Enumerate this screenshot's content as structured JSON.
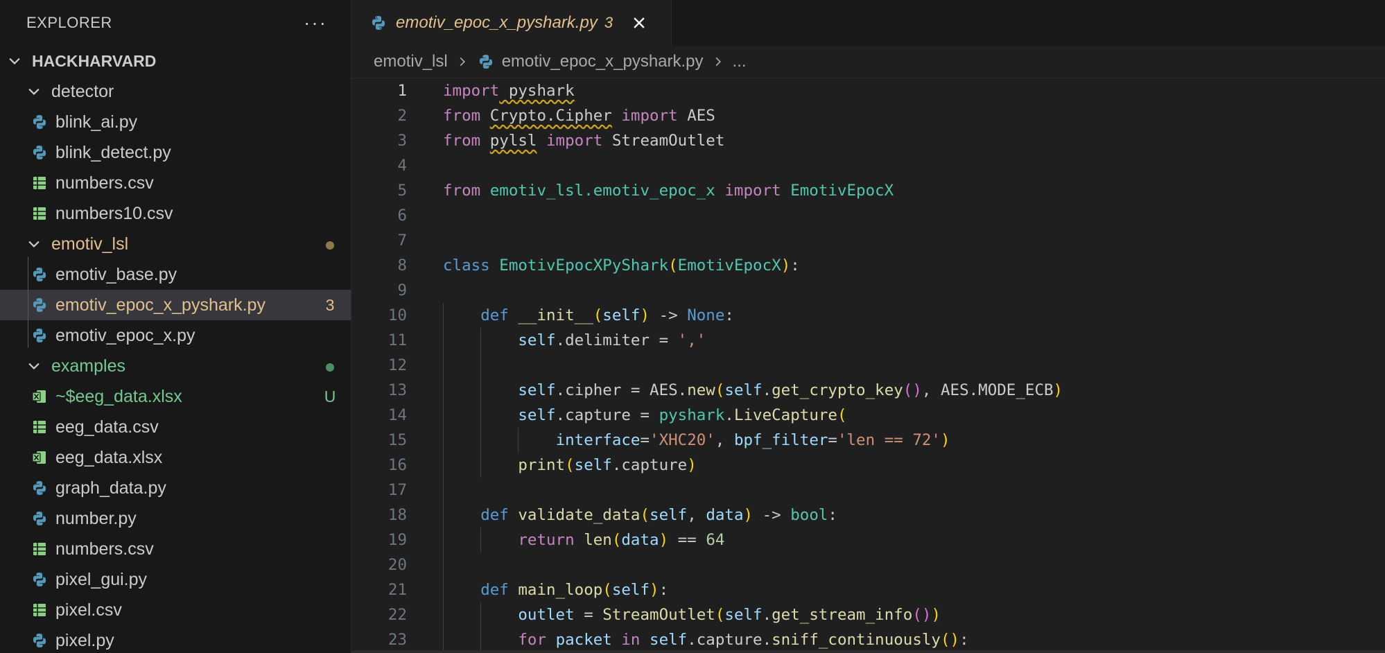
{
  "explorer": {
    "title": "EXPLORER",
    "more": "···",
    "workspace": "HACKHARVARD",
    "items": [
      {
        "type": "folder",
        "label": "detector",
        "color": "#cccccc",
        "badge": ""
      },
      {
        "type": "py",
        "label": "blink_ai.py",
        "color": "#cccccc",
        "badge": ""
      },
      {
        "type": "py",
        "label": "blink_detect.py",
        "color": "#cccccc",
        "badge": ""
      },
      {
        "type": "csv",
        "label": "numbers.csv",
        "color": "#cccccc",
        "badge": ""
      },
      {
        "type": "csv",
        "label": "numbers10.csv",
        "color": "#cccccc",
        "badge": ""
      },
      {
        "type": "folder",
        "label": "emotiv_lsl",
        "color": "#e2c08d",
        "badge": "dot-modified"
      },
      {
        "type": "py",
        "label": "emotiv_base.py",
        "color": "#cccccc",
        "badge": ""
      },
      {
        "type": "py",
        "label": "emotiv_epoc_x_pyshark.py",
        "color": "#e2c08d",
        "badge": "3",
        "selected": true
      },
      {
        "type": "py",
        "label": "emotiv_epoc_x.py",
        "color": "#cccccc",
        "badge": ""
      },
      {
        "type": "folder",
        "label": "examples",
        "color": "#73c991",
        "badge": "dot-untracked"
      },
      {
        "type": "xlsx",
        "label": "~$eeg_data.xlsx",
        "color": "#73c991",
        "badge": "U"
      },
      {
        "type": "csv",
        "label": "eeg_data.csv",
        "color": "#cccccc",
        "badge": ""
      },
      {
        "type": "xlsx",
        "label": "eeg_data.xlsx",
        "color": "#cccccc",
        "badge": ""
      },
      {
        "type": "py",
        "label": "graph_data.py",
        "color": "#cccccc",
        "badge": ""
      },
      {
        "type": "py",
        "label": "number.py",
        "color": "#cccccc",
        "badge": ""
      },
      {
        "type": "csv",
        "label": "numbers.csv",
        "color": "#cccccc",
        "badge": ""
      },
      {
        "type": "py",
        "label": "pixel_gui.py",
        "color": "#cccccc",
        "badge": ""
      },
      {
        "type": "csv",
        "label": "pixel.csv",
        "color": "#cccccc",
        "badge": ""
      },
      {
        "type": "py",
        "label": "pixel.py",
        "color": "#cccccc",
        "badge": ""
      }
    ]
  },
  "tab": {
    "title": "emotiv_epoc_x_pyshark.py",
    "count": "3"
  },
  "breadcrumb": {
    "folder": "emotiv_lsl",
    "file": "emotiv_epoc_x_pyshark.py",
    "more": "..."
  },
  "colors": {
    "modified": "#e2c08d",
    "untracked": "#73c991",
    "python": "#519aba",
    "csv": "#89d185"
  },
  "code_lines": [
    {
      "n": "1",
      "indent": 0,
      "tokens": [
        [
          "kw",
          "import"
        ],
        [
          "",
          ""
        ],
        [
          "sq",
          " pyshark"
        ]
      ]
    },
    {
      "n": "2",
      "indent": 0,
      "tokens": [
        [
          "kw",
          "from"
        ],
        [
          "",
          " "
        ],
        [
          "sq",
          "Crypto.Cipher"
        ],
        [
          "",
          " "
        ],
        [
          "kw",
          "import"
        ],
        [
          "",
          " AES"
        ]
      ]
    },
    {
      "n": "3",
      "indent": 0,
      "tokens": [
        [
          "kw",
          "from"
        ],
        [
          "",
          " "
        ],
        [
          "sq",
          "pylsl"
        ],
        [
          "",
          " "
        ],
        [
          "kw",
          "import"
        ],
        [
          "",
          " StreamOutlet"
        ]
      ]
    },
    {
      "n": "4",
      "indent": 0,
      "tokens": []
    },
    {
      "n": "5",
      "indent": 0,
      "tokens": [
        [
          "kw",
          "from"
        ],
        [
          "",
          " "
        ],
        [
          "cls",
          "emotiv_lsl.emotiv_epoc_x"
        ],
        [
          "",
          " "
        ],
        [
          "kw",
          "import"
        ],
        [
          "",
          " "
        ],
        [
          "cls",
          "EmotivEpocX"
        ]
      ]
    },
    {
      "n": "6",
      "indent": 0,
      "tokens": []
    },
    {
      "n": "7",
      "indent": 0,
      "tokens": []
    },
    {
      "n": "8",
      "indent": 0,
      "tokens": [
        [
          "kwd",
          "class"
        ],
        [
          "",
          " "
        ],
        [
          "cls",
          "EmotivEpocXPyShark"
        ],
        [
          "paren",
          "("
        ],
        [
          "cls",
          "EmotivEpocX"
        ],
        [
          "paren",
          ")"
        ],
        [
          "",
          ":"
        ]
      ]
    },
    {
      "n": "9",
      "indent": 0,
      "tokens": []
    },
    {
      "n": "10",
      "indent": 1,
      "tokens": [
        [
          "kwd",
          "def"
        ],
        [
          "",
          " "
        ],
        [
          "fn",
          "__init__"
        ],
        [
          "paren",
          "("
        ],
        [
          "var",
          "self"
        ],
        [
          "paren",
          ")"
        ],
        [
          "",
          " -> "
        ],
        [
          "kwd",
          "None"
        ],
        [
          "",
          ":"
        ]
      ]
    },
    {
      "n": "11",
      "indent": 2,
      "tokens": [
        [
          "var",
          "self"
        ],
        [
          "",
          ".delimiter = "
        ],
        [
          "str",
          "','"
        ]
      ]
    },
    {
      "n": "12",
      "indent": 2,
      "tokens": []
    },
    {
      "n": "13",
      "indent": 2,
      "tokens": [
        [
          "var",
          "self"
        ],
        [
          "",
          ".cipher = AES."
        ],
        [
          "fn",
          "new"
        ],
        [
          "paren",
          "("
        ],
        [
          "var",
          "self"
        ],
        [
          "",
          "."
        ],
        [
          "fn",
          "get_crypto_key"
        ],
        [
          "paren2",
          "()"
        ],
        [
          "",
          ", AES.MODE_ECB"
        ],
        [
          "paren",
          ")"
        ]
      ]
    },
    {
      "n": "14",
      "indent": 2,
      "tokens": [
        [
          "var",
          "self"
        ],
        [
          "",
          ".capture = "
        ],
        [
          "cls",
          "pyshark"
        ],
        [
          "",
          "."
        ],
        [
          "fn",
          "LiveCapture"
        ],
        [
          "paren",
          "("
        ]
      ]
    },
    {
      "n": "15",
      "indent": 3,
      "tokens": [
        [
          "var",
          "interface"
        ],
        [
          "",
          "="
        ],
        [
          "str",
          "'XHC20'"
        ],
        [
          "",
          ", "
        ],
        [
          "var",
          "bpf_filter"
        ],
        [
          "",
          "="
        ],
        [
          "str",
          "'len == 72'"
        ],
        [
          "paren",
          ")"
        ]
      ]
    },
    {
      "n": "16",
      "indent": 2,
      "tokens": [
        [
          "fn",
          "print"
        ],
        [
          "paren",
          "("
        ],
        [
          "var",
          "self"
        ],
        [
          "",
          ".capture"
        ],
        [
          "paren",
          ")"
        ]
      ]
    },
    {
      "n": "17",
      "indent": 1,
      "tokens": []
    },
    {
      "n": "18",
      "indent": 1,
      "tokens": [
        [
          "kwd",
          "def"
        ],
        [
          "",
          " "
        ],
        [
          "fn",
          "validate_data"
        ],
        [
          "paren",
          "("
        ],
        [
          "var",
          "self"
        ],
        [
          "",
          ", "
        ],
        [
          "var",
          "data"
        ],
        [
          "paren",
          ")"
        ],
        [
          "",
          " -> "
        ],
        [
          "cls",
          "bool"
        ],
        [
          "",
          ":"
        ]
      ]
    },
    {
      "n": "19",
      "indent": 2,
      "tokens": [
        [
          "kw",
          "return"
        ],
        [
          "",
          " "
        ],
        [
          "fn",
          "len"
        ],
        [
          "paren",
          "("
        ],
        [
          "var",
          "data"
        ],
        [
          "paren",
          ")"
        ],
        [
          "",
          " == "
        ],
        [
          "num",
          "64"
        ]
      ]
    },
    {
      "n": "20",
      "indent": 1,
      "tokens": []
    },
    {
      "n": "21",
      "indent": 1,
      "tokens": [
        [
          "kwd",
          "def"
        ],
        [
          "",
          " "
        ],
        [
          "fn",
          "main_loop"
        ],
        [
          "paren",
          "("
        ],
        [
          "var",
          "self"
        ],
        [
          "paren",
          ")"
        ],
        [
          "",
          ":"
        ]
      ]
    },
    {
      "n": "22",
      "indent": 2,
      "tokens": [
        [
          "var",
          "outlet"
        ],
        [
          "",
          " = "
        ],
        [
          "fn",
          "StreamOutlet"
        ],
        [
          "paren",
          "("
        ],
        [
          "var",
          "self"
        ],
        [
          "",
          "."
        ],
        [
          "fn",
          "get_stream_info"
        ],
        [
          "paren2",
          "()"
        ],
        [
          "paren",
          ")"
        ]
      ]
    },
    {
      "n": "23",
      "indent": 2,
      "tokens": [
        [
          "kw",
          "for"
        ],
        [
          "",
          " "
        ],
        [
          "var",
          "packet"
        ],
        [
          "",
          " "
        ],
        [
          "kw",
          "in"
        ],
        [
          "",
          " "
        ],
        [
          "var",
          "self"
        ],
        [
          "",
          ".capture."
        ],
        [
          "fn",
          "sniff_continuously"
        ],
        [
          "paren",
          "()"
        ],
        [
          "",
          ":"
        ]
      ]
    }
  ]
}
